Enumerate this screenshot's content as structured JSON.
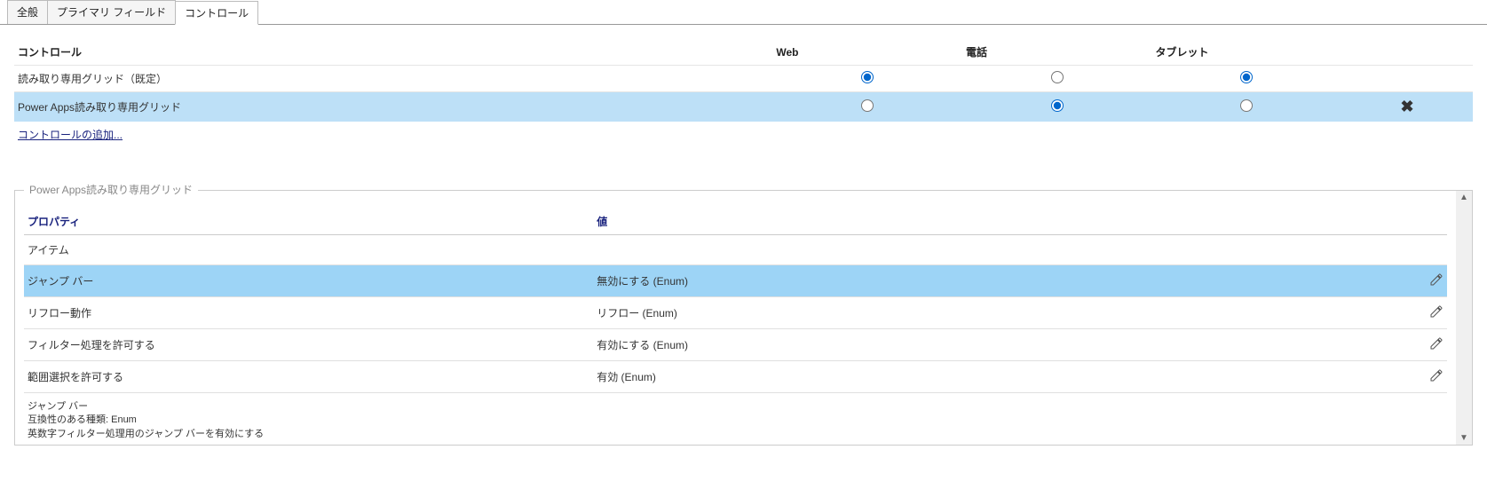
{
  "tabs": [
    {
      "label": "全般"
    },
    {
      "label": "プライマリ フィールド"
    },
    {
      "label": "コントロール"
    }
  ],
  "active_tab": 2,
  "controls": {
    "headers": {
      "control": "コントロール",
      "web": "Web",
      "phone": "電話",
      "tablet": "タブレット"
    },
    "rows": [
      {
        "name": "読み取り専用グリッド（既定）",
        "web": true,
        "phone": false,
        "tablet": true,
        "deletable": false,
        "highlight": false
      },
      {
        "name": "Power Apps読み取り専用グリッド",
        "web": false,
        "phone": true,
        "tablet": false,
        "deletable": true,
        "highlight": true
      }
    ],
    "add_link": "コントロールの追加..."
  },
  "panel": {
    "legend": "Power Apps読み取り専用グリッド",
    "headers": {
      "property": "プロパティ",
      "value": "値"
    },
    "rows": [
      {
        "name": "アイテム",
        "value": "",
        "editable": false,
        "selected": false
      },
      {
        "name": "ジャンプ バー",
        "value": "無効にする (Enum)",
        "editable": true,
        "selected": true
      },
      {
        "name": "リフロー動作",
        "value": "リフロー (Enum)",
        "editable": true,
        "selected": false
      },
      {
        "name": "フィルター処理を許可する",
        "value": "有効にする (Enum)",
        "editable": true,
        "selected": false
      },
      {
        "name": "範囲選択を許可する",
        "value": "有効 (Enum)",
        "editable": true,
        "selected": false
      }
    ],
    "footer": {
      "title": "ジャンプ バー",
      "type_line": "互換性のある種類: Enum",
      "desc": "英数字フィルター処理用のジャンプ バーを有効にする"
    }
  }
}
